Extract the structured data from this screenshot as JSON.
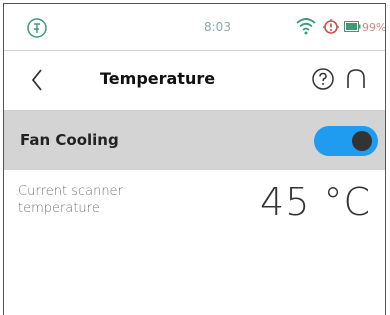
{
  "status_bar": {
    "time": "8:03",
    "battery_percent": "99%",
    "app_icon": "app-badge-icon",
    "wifi_icon": "wifi-icon",
    "alert_icon": "alert-sync-icon",
    "battery_icon": "battery-icon",
    "accent_color": "#3f9a78"
  },
  "header": {
    "title": "Temperature",
    "back_icon": "chevron-left-icon",
    "help_icon": "help-circle-icon",
    "collapse_icon": "chevron-up-icon"
  },
  "fan_cooling": {
    "label": "Fan Cooling",
    "enabled": true,
    "toggle_color": "#1f9cf0"
  },
  "scanner_temperature": {
    "label": "Current scanner temperature",
    "value": "45 °C"
  }
}
